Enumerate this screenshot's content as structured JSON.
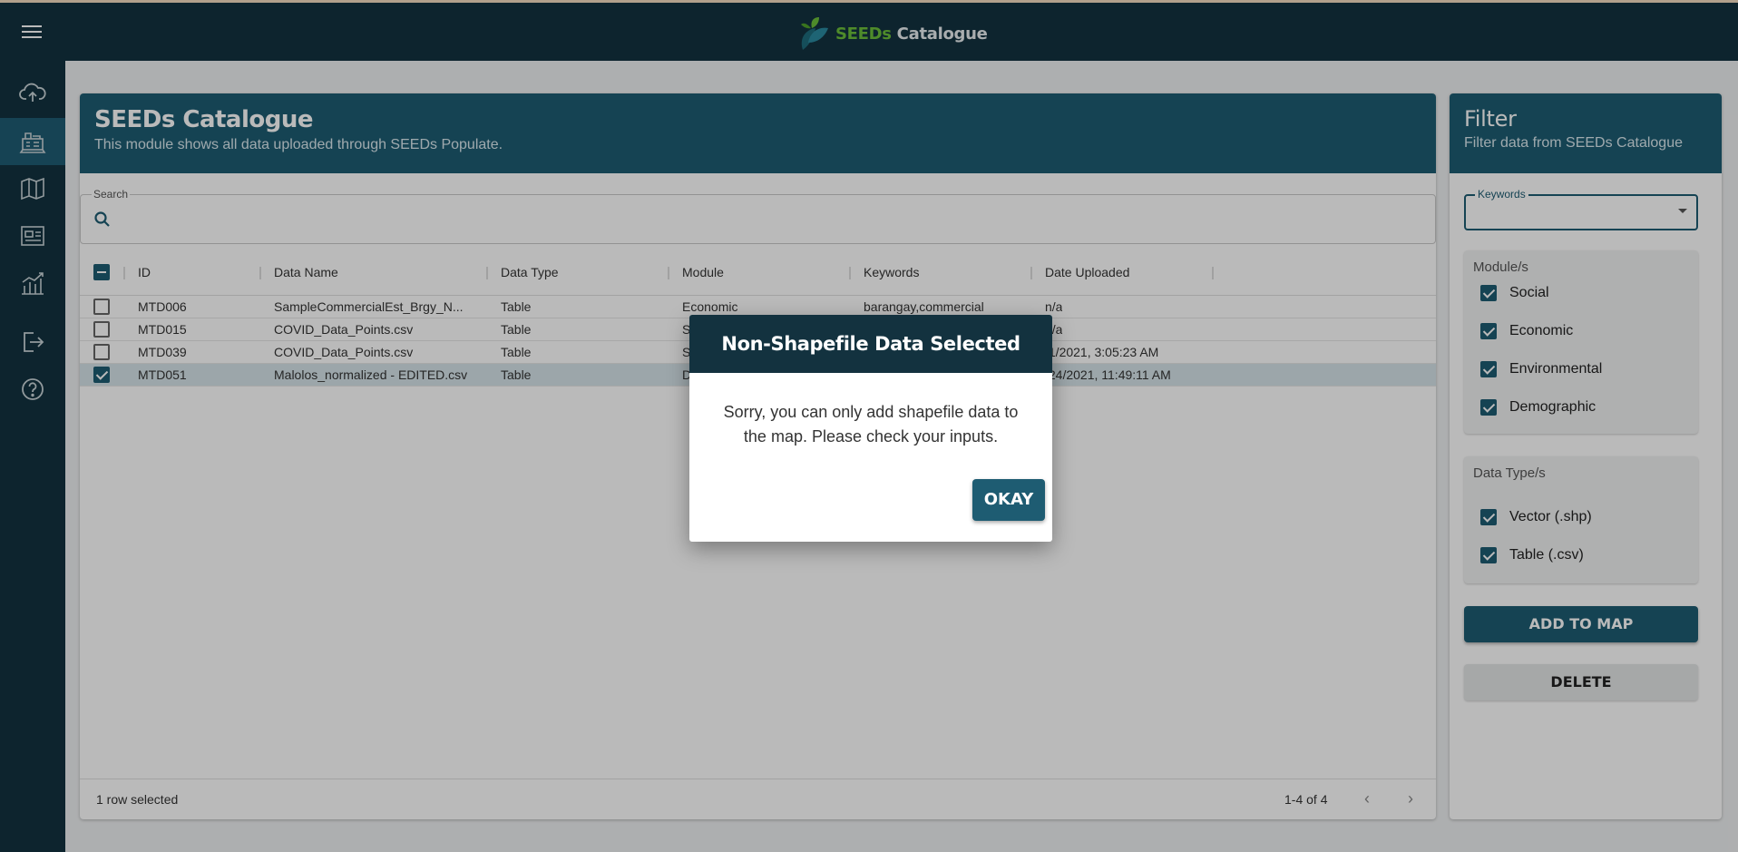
{
  "app": {
    "brand_accent": "SEEDs",
    "brand_rest": " Catalogue",
    "menu_icon": "hamburger-menu-icon",
    "accent_color": "#1e5c72",
    "dark_color": "#13323f"
  },
  "sidebar": {
    "items": [
      {
        "icon": "cloud-upload-icon"
      },
      {
        "icon": "catalogue-icon",
        "active": true
      },
      {
        "icon": "map-icon"
      },
      {
        "icon": "dashboard-icon"
      },
      {
        "icon": "analytics-icon"
      },
      {
        "icon": "logout-icon"
      },
      {
        "icon": "help-icon"
      }
    ]
  },
  "main": {
    "title": "SEEDs Catalogue",
    "subtitle": "This module shows all data uploaded through SEEDs Populate.",
    "search": {
      "label": "Search",
      "value": ""
    },
    "columns": [
      "ID",
      "Data Name",
      "Data Type",
      "Module",
      "Keywords",
      "Date Uploaded"
    ],
    "rows": [
      {
        "id": "MTD006",
        "name": "SampleCommercialEst_Brgy_N...",
        "type": "Table",
        "module": "Economic",
        "keywords": "barangay,commercial",
        "date": "n/a",
        "checked": false
      },
      {
        "id": "MTD015",
        "name": "COVID_Data_Points.csv",
        "type": "Table",
        "module": "S",
        "keywords": "",
        "date": "n/a",
        "checked": false
      },
      {
        "id": "MTD039",
        "name": "COVID_Data_Points.csv",
        "type": "Table",
        "module": "S",
        "keywords": "",
        "date": "/1/2021, 3:05:23 AM",
        "checked": false
      },
      {
        "id": "MTD051",
        "name": "Malolos_normalized - EDITED.csv",
        "type": "Table",
        "module": "D",
        "keywords": "",
        "date": "/24/2021, 11:49:11 AM",
        "checked": true
      }
    ],
    "footer": {
      "selected": "1 row selected",
      "pagination": "1-4 of 4",
      "prev": "‹",
      "next": "›"
    }
  },
  "filter": {
    "title": "Filter",
    "subtitle": "Filter data from SEEDs Catalogue",
    "keywords_label": "Keywords",
    "modules_title": "Module/s",
    "modules": [
      "Social",
      "Economic",
      "Environmental",
      "Demographic"
    ],
    "types_title": "Data Type/s",
    "types": [
      "Vector (.shp)",
      "Table (.csv)"
    ],
    "add_label": "ADD TO MAP",
    "delete_label": "DELETE"
  },
  "dialog": {
    "title": "Non-Shapefile Data Selected",
    "message": "Sorry, you can only add shapefile data to the map. Please check your inputs.",
    "ok_label": "OKAY"
  }
}
